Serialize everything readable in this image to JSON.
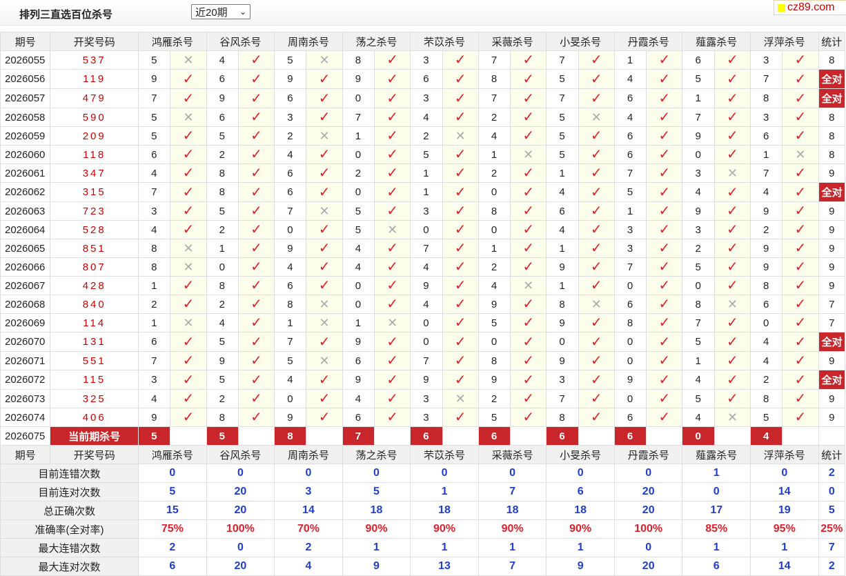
{
  "header": {
    "title": "排列三直选百位杀号",
    "period_select": "近20期",
    "site_badge": "cz89.com"
  },
  "columns": {
    "issue": "期号",
    "draw": "开奖号码",
    "killers": [
      "鸿雁杀号",
      "谷风杀号",
      "周南杀号",
      "荡之杀号",
      "芣苡杀号",
      "采薇杀号",
      "小旻杀号",
      "丹霞杀号",
      "薤露杀号",
      "浮萍杀号"
    ],
    "stat": "统计"
  },
  "marks": {
    "ok": "✓",
    "no": "✕"
  },
  "rows": [
    {
      "issue": "2026055",
      "draw": "537",
      "k": [
        "5",
        "4",
        "5",
        "8",
        "3",
        "7",
        "7",
        "1",
        "6",
        "3"
      ],
      "r": [
        0,
        1,
        0,
        1,
        1,
        1,
        1,
        1,
        1,
        1
      ],
      "stat": "8"
    },
    {
      "issue": "2026056",
      "draw": "119",
      "k": [
        "9",
        "6",
        "9",
        "9",
        "6",
        "8",
        "5",
        "4",
        "5",
        "7"
      ],
      "r": [
        1,
        1,
        1,
        1,
        1,
        1,
        1,
        1,
        1,
        1
      ],
      "stat": "全对"
    },
    {
      "issue": "2026057",
      "draw": "479",
      "k": [
        "7",
        "9",
        "6",
        "0",
        "3",
        "7",
        "7",
        "6",
        "1",
        "8"
      ],
      "r": [
        1,
        1,
        1,
        1,
        1,
        1,
        1,
        1,
        1,
        1
      ],
      "stat": "全对"
    },
    {
      "issue": "2026058",
      "draw": "590",
      "k": [
        "5",
        "6",
        "3",
        "7",
        "4",
        "2",
        "5",
        "4",
        "7",
        "3"
      ],
      "r": [
        0,
        1,
        1,
        1,
        1,
        1,
        0,
        1,
        1,
        1
      ],
      "stat": "8"
    },
    {
      "issue": "2026059",
      "draw": "209",
      "k": [
        "5",
        "5",
        "2",
        "1",
        "2",
        "4",
        "5",
        "6",
        "9",
        "6"
      ],
      "r": [
        1,
        1,
        0,
        1,
        0,
        1,
        1,
        1,
        1,
        1
      ],
      "stat": "8"
    },
    {
      "issue": "2026060",
      "draw": "118",
      "k": [
        "6",
        "2",
        "4",
        "0",
        "5",
        "1",
        "5",
        "6",
        "0",
        "1"
      ],
      "r": [
        1,
        1,
        1,
        1,
        1,
        0,
        1,
        1,
        1,
        0
      ],
      "stat": "8"
    },
    {
      "issue": "2026061",
      "draw": "347",
      "k": [
        "4",
        "8",
        "6",
        "2",
        "1",
        "2",
        "1",
        "7",
        "3",
        "7"
      ],
      "r": [
        1,
        1,
        1,
        1,
        1,
        1,
        1,
        1,
        0,
        1
      ],
      "stat": "9"
    },
    {
      "issue": "2026062",
      "draw": "315",
      "k": [
        "7",
        "8",
        "6",
        "0",
        "1",
        "0",
        "4",
        "5",
        "4",
        "4"
      ],
      "r": [
        1,
        1,
        1,
        1,
        1,
        1,
        1,
        1,
        1,
        1
      ],
      "stat": "全对"
    },
    {
      "issue": "2026063",
      "draw": "723",
      "k": [
        "3",
        "5",
        "7",
        "5",
        "3",
        "8",
        "6",
        "1",
        "9",
        "9"
      ],
      "r": [
        1,
        1,
        0,
        1,
        1,
        1,
        1,
        1,
        1,
        1
      ],
      "stat": "9"
    },
    {
      "issue": "2026064",
      "draw": "528",
      "k": [
        "4",
        "2",
        "0",
        "5",
        "0",
        "0",
        "4",
        "3",
        "3",
        "2"
      ],
      "r": [
        1,
        1,
        1,
        0,
        1,
        1,
        1,
        1,
        1,
        1
      ],
      "stat": "9"
    },
    {
      "issue": "2026065",
      "draw": "851",
      "k": [
        "8",
        "1",
        "9",
        "4",
        "7",
        "1",
        "1",
        "3",
        "2",
        "9"
      ],
      "r": [
        0,
        1,
        1,
        1,
        1,
        1,
        1,
        1,
        1,
        1
      ],
      "stat": "9"
    },
    {
      "issue": "2026066",
      "draw": "807",
      "k": [
        "8",
        "0",
        "4",
        "4",
        "4",
        "2",
        "9",
        "7",
        "5",
        "9"
      ],
      "r": [
        0,
        1,
        1,
        1,
        1,
        1,
        1,
        1,
        1,
        1
      ],
      "stat": "9"
    },
    {
      "issue": "2026067",
      "draw": "428",
      "k": [
        "1",
        "8",
        "6",
        "0",
        "9",
        "4",
        "1",
        "0",
        "0",
        "8"
      ],
      "r": [
        1,
        1,
        1,
        1,
        1,
        0,
        1,
        1,
        1,
        1
      ],
      "stat": "9"
    },
    {
      "issue": "2026068",
      "draw": "840",
      "k": [
        "2",
        "2",
        "8",
        "0",
        "4",
        "9",
        "8",
        "6",
        "8",
        "6"
      ],
      "r": [
        1,
        1,
        0,
        1,
        1,
        1,
        0,
        1,
        0,
        1
      ],
      "stat": "7"
    },
    {
      "issue": "2026069",
      "draw": "114",
      "k": [
        "1",
        "4",
        "1",
        "1",
        "0",
        "5",
        "9",
        "8",
        "7",
        "0"
      ],
      "r": [
        0,
        1,
        0,
        0,
        1,
        1,
        1,
        1,
        1,
        1
      ],
      "stat": "7"
    },
    {
      "issue": "2026070",
      "draw": "131",
      "k": [
        "6",
        "5",
        "7",
        "9",
        "0",
        "0",
        "0",
        "0",
        "5",
        "4"
      ],
      "r": [
        1,
        1,
        1,
        1,
        1,
        1,
        1,
        1,
        1,
        1
      ],
      "stat": "全对"
    },
    {
      "issue": "2026071",
      "draw": "551",
      "k": [
        "7",
        "9",
        "5",
        "6",
        "7",
        "8",
        "9",
        "0",
        "1",
        "4"
      ],
      "r": [
        1,
        1,
        0,
        1,
        1,
        1,
        1,
        1,
        1,
        1
      ],
      "stat": "9"
    },
    {
      "issue": "2026072",
      "draw": "115",
      "k": [
        "3",
        "5",
        "4",
        "9",
        "9",
        "9",
        "3",
        "9",
        "4",
        "2"
      ],
      "r": [
        1,
        1,
        1,
        1,
        1,
        1,
        1,
        1,
        1,
        1
      ],
      "stat": "全对"
    },
    {
      "issue": "2026073",
      "draw": "325",
      "k": [
        "4",
        "2",
        "0",
        "4",
        "3",
        "2",
        "7",
        "0",
        "5",
        "8"
      ],
      "r": [
        1,
        1,
        1,
        1,
        0,
        1,
        1,
        1,
        1,
        1
      ],
      "stat": "9"
    },
    {
      "issue": "2026074",
      "draw": "406",
      "k": [
        "9",
        "8",
        "9",
        "6",
        "3",
        "5",
        "8",
        "6",
        "4",
        "5"
      ],
      "r": [
        1,
        1,
        1,
        1,
        1,
        1,
        1,
        1,
        0,
        1
      ],
      "stat": "9"
    }
  ],
  "current": {
    "issue": "2026075",
    "label": "当前期杀号",
    "k": [
      "5",
      "5",
      "8",
      "7",
      "6",
      "6",
      "6",
      "6",
      "0",
      "4"
    ]
  },
  "stats": [
    {
      "label": "目前连错次数",
      "v": [
        "0",
        "0",
        "0",
        "0",
        "0",
        "0",
        "0",
        "0",
        "1",
        "0"
      ],
      "stat": "2",
      "red": false
    },
    {
      "label": "目前连对次数",
      "v": [
        "5",
        "20",
        "3",
        "5",
        "1",
        "7",
        "6",
        "20",
        "0",
        "14"
      ],
      "stat": "0",
      "red": false
    },
    {
      "label": "总正确次数",
      "v": [
        "15",
        "20",
        "14",
        "18",
        "18",
        "18",
        "18",
        "20",
        "17",
        "19"
      ],
      "stat": "5",
      "red": false
    },
    {
      "label": "准确率(全对率)",
      "v": [
        "75%",
        "100%",
        "70%",
        "90%",
        "90%",
        "90%",
        "90%",
        "100%",
        "85%",
        "95%"
      ],
      "stat": "25%",
      "red": true
    },
    {
      "label": "最大连错次数",
      "v": [
        "2",
        "0",
        "2",
        "1",
        "1",
        "1",
        "1",
        "0",
        "1",
        "1"
      ],
      "stat": "7",
      "red": false
    },
    {
      "label": "最大连对次数",
      "v": [
        "6",
        "20",
        "4",
        "9",
        "13",
        "7",
        "9",
        "20",
        "6",
        "14"
      ],
      "stat": "2",
      "red": false
    }
  ]
}
